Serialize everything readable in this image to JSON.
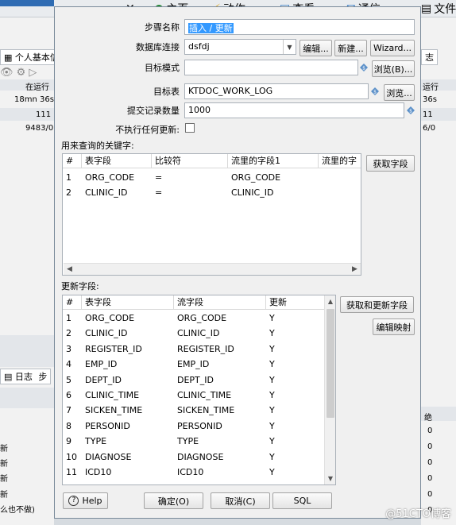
{
  "background": {
    "toolbar": {
      "home": "主页",
      "action": "动作",
      "view": "查看",
      "comm": "通信",
      "file": "文件"
    },
    "left_tab": "个人基本信息",
    "left_status": {
      "header": "在运行",
      "row1": "18mn 36s",
      "row2": "111",
      "row3": "9483/0"
    },
    "right_status": {
      "tab": "志",
      "header": "运行",
      "row1": "36s",
      "row2": "11",
      "row3": "6/0"
    },
    "bottom_left": {
      "log_tab": "日志",
      "step_tab": "步",
      "rows": [
        "新",
        "新",
        "新",
        "新",
        "么也不做)"
      ]
    },
    "bottom_right": {
      "header": "绝",
      "rows": [
        "0",
        "0",
        "0",
        "0",
        "0",
        "0"
      ]
    },
    "watermark": "@51CTO博客"
  },
  "dialog": {
    "step_name_label": "步骤名称",
    "step_name_value": "插入 / 更新",
    "db_conn_label": "数据库连接",
    "db_conn_value": "dsfdj",
    "edit_btn": "编辑...",
    "new_btn": "新建...",
    "wizard_btn": "Wizard...",
    "schema_label": "目标模式",
    "schema_value": "",
    "browse_b_btn": "浏览(B)...",
    "table_label": "目标表",
    "table_value": "KTDOC_WORK_LOG",
    "browse_btn": "浏览...",
    "commit_label": "提交记录数量",
    "commit_value": "1000",
    "no_update_label": "不执行任何更新:",
    "keys_label": "用来查询的关键字:",
    "get_fields_btn": "获取字段",
    "keys_table": {
      "headers": [
        "#",
        "表字段",
        "比较符",
        "流里的字段1",
        "流里的字"
      ],
      "rows": [
        [
          "1",
          "ORG_CODE",
          "=",
          "ORG_CODE",
          ""
        ],
        [
          "2",
          "CLINIC_ID",
          "=",
          "CLINIC_ID",
          ""
        ]
      ]
    },
    "update_label": "更新字段:",
    "get_update_btn": "获取和更新字段",
    "edit_mapping_btn": "编辑映射",
    "update_table": {
      "headers": [
        "#",
        "表字段",
        "流字段",
        "更新"
      ],
      "rows": [
        [
          "1",
          "ORG_CODE",
          "ORG_CODE",
          "Y"
        ],
        [
          "2",
          "CLINIC_ID",
          "CLINIC_ID",
          "Y"
        ],
        [
          "3",
          "REGISTER_ID",
          "REGISTER_ID",
          "Y"
        ],
        [
          "4",
          "EMP_ID",
          "EMP_ID",
          "Y"
        ],
        [
          "5",
          "DEPT_ID",
          "DEPT_ID",
          "Y"
        ],
        [
          "6",
          "CLINIC_TIME",
          "CLINIC_TIME",
          "Y"
        ],
        [
          "7",
          "SICKEN_TIME",
          "SICKEN_TIME",
          "Y"
        ],
        [
          "8",
          "PERSONID",
          "PERSONID",
          "Y"
        ],
        [
          "9",
          "TYPE",
          "TYPE",
          "Y"
        ],
        [
          "10",
          "DIAGNOSE",
          "DIAGNOSE",
          "Y"
        ],
        [
          "11",
          "ICD10",
          "ICD10",
          "Y"
        ]
      ]
    },
    "help_btn": "Help",
    "ok_btn": "确定(O)",
    "cancel_btn": "取消(C)",
    "sql_btn": "SQL"
  },
  "colors": {
    "selection": "#3399ff",
    "dialog_bg": "#f0f0f0",
    "accent_blue": "#2f6cb3"
  }
}
